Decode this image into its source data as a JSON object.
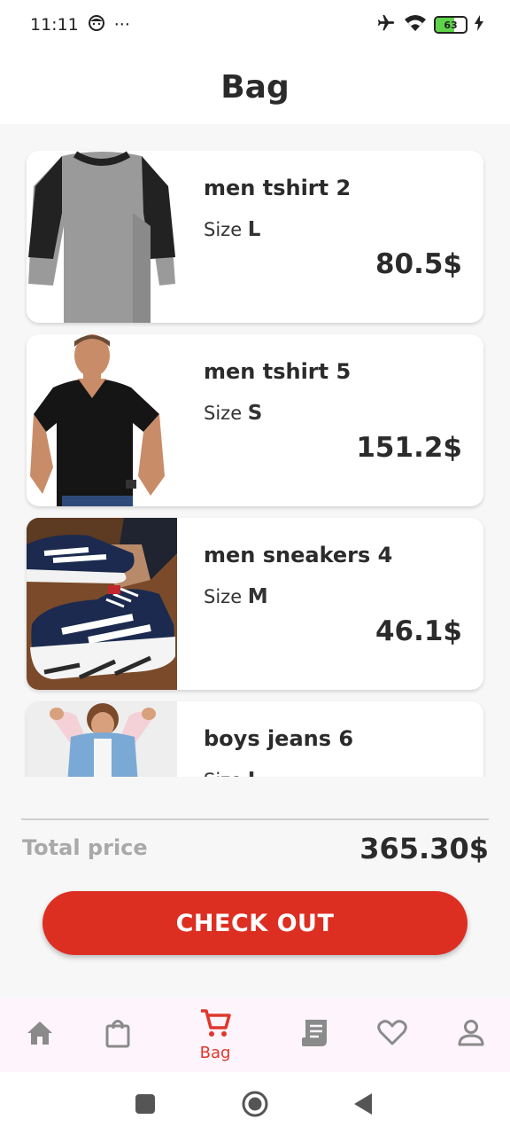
{
  "status_bar": {
    "time": "11:11",
    "more": "···",
    "battery": "63"
  },
  "header": {
    "title": "Bag"
  },
  "items": [
    {
      "name": "men tshirt 2",
      "size_label": "Size",
      "size": "L",
      "price": "80.5$",
      "image": "grey-raglan-tshirt"
    },
    {
      "name": "men tshirt 5",
      "size_label": "Size",
      "size": "S",
      "price": "151.2$",
      "image": "man-black-vneck-tshirt"
    },
    {
      "name": "men sneakers 4",
      "size_label": "Size",
      "size": "M",
      "price": "46.1$",
      "image": "navy-white-sneakers"
    },
    {
      "name": "boys jeans 6",
      "size_label": "Size",
      "size": "L",
      "price": "",
      "image": "boy-denim-jacket"
    }
  ],
  "summary": {
    "total_label": "Total price",
    "total_value": "365.30$"
  },
  "checkout": {
    "label": "CHECK OUT"
  },
  "bottom_nav": {
    "items": [
      {
        "icon": "home-icon",
        "label": ""
      },
      {
        "icon": "shopping-bag-icon",
        "label": ""
      },
      {
        "icon": "cart-icon",
        "label": "Bag",
        "active": true
      },
      {
        "icon": "orders-icon",
        "label": ""
      },
      {
        "icon": "heart-icon",
        "label": ""
      },
      {
        "icon": "profile-icon",
        "label": ""
      }
    ]
  },
  "colors": {
    "accent": "#dd2e22",
    "muted_text": "#a9a9a9",
    "nav_icon": "#8a8a8a",
    "nav_bg": "#fdf5fb"
  }
}
